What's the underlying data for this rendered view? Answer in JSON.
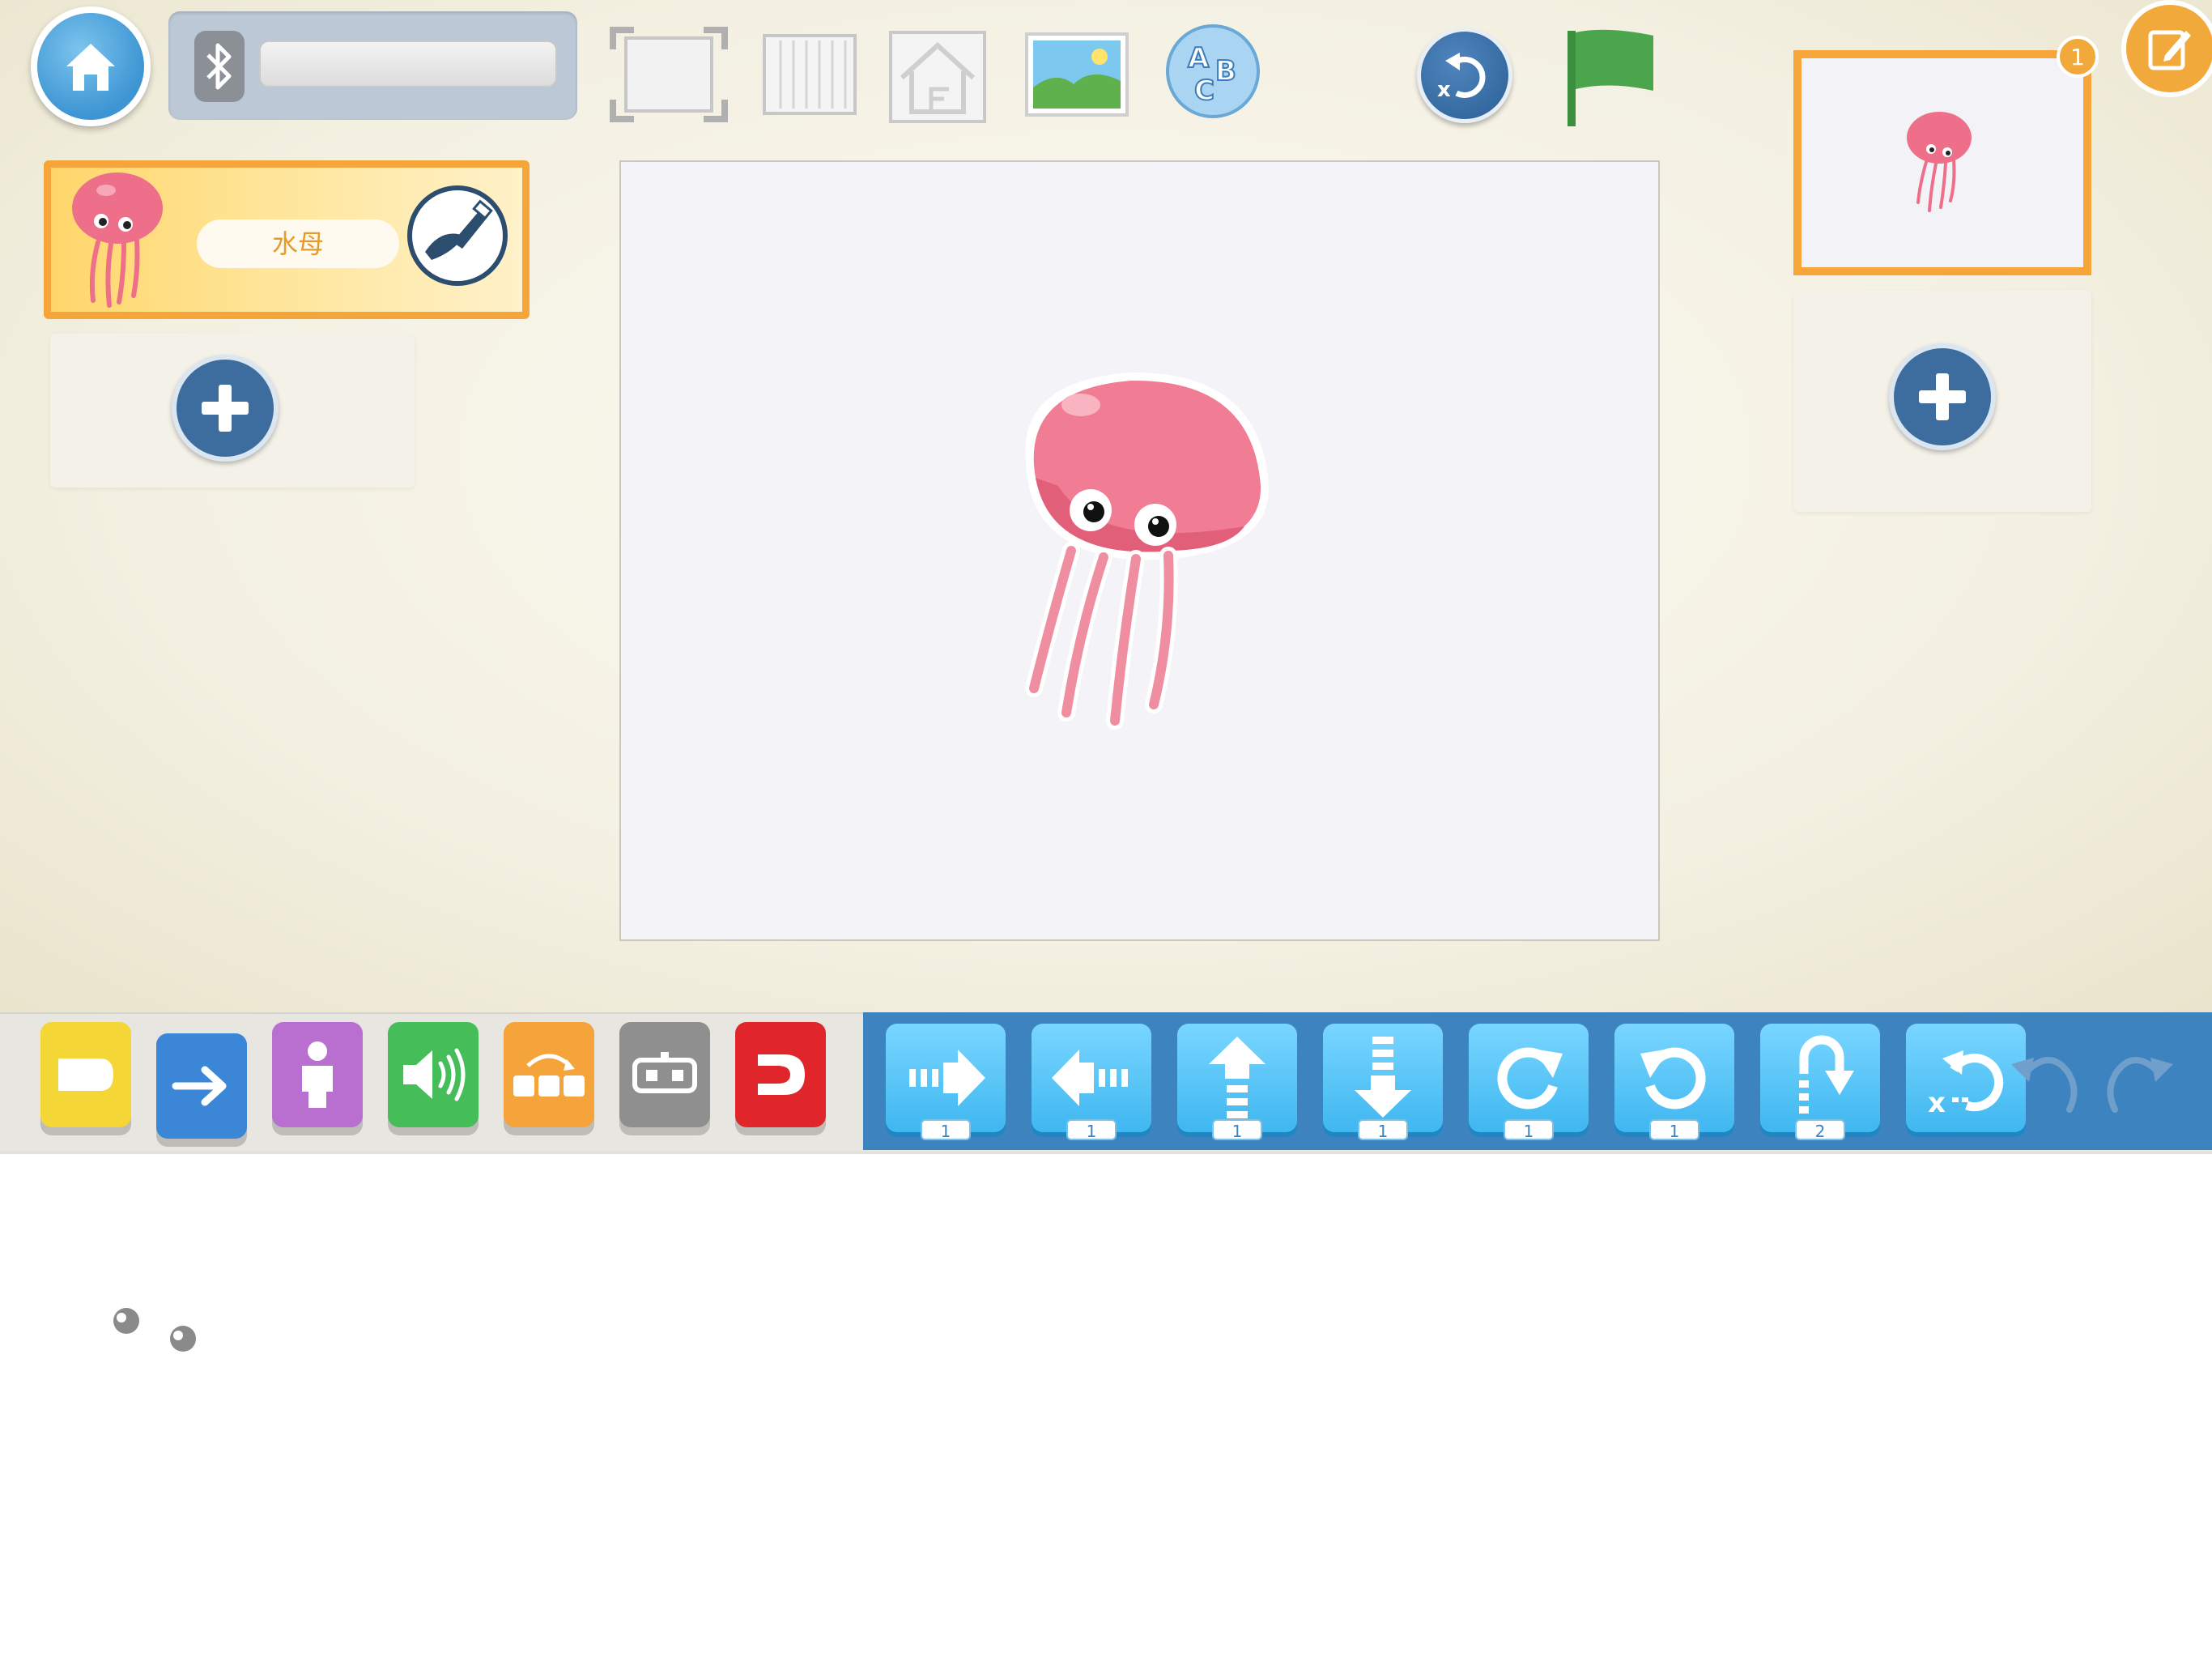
{
  "toolbar": {
    "home_icon": "home-icon",
    "bluetooth_icon": "bluetooth-icon",
    "device_name": "",
    "tools": [
      "fullscreen-icon",
      "grid-icon",
      "page-home-icon",
      "background-icon",
      "text-abc-icon"
    ],
    "reset_icon": "reset-icon",
    "green_flag_icon": "green-flag-icon"
  },
  "sprites": {
    "items": [
      {
        "name": "水母",
        "icon": "jellyfish-icon"
      }
    ],
    "add_icon": "plus-icon"
  },
  "pages": {
    "count_badge": "1",
    "add_icon": "plus-icon",
    "options_icon": "edit-icon"
  },
  "categories": [
    {
      "id": "triggering",
      "color": "#f4d636",
      "icon": "trigger-icon"
    },
    {
      "id": "motion",
      "color": "#3b86d6",
      "icon": "arrow-right-icon"
    },
    {
      "id": "looks",
      "color": "#b96fd0",
      "icon": "person-icon"
    },
    {
      "id": "sound",
      "color": "#45be5a",
      "icon": "speaker-icon"
    },
    {
      "id": "control",
      "color": "#f4a43b",
      "icon": "control-icon"
    },
    {
      "id": "hardware",
      "color": "#8f8f8f",
      "icon": "robot-icon"
    },
    {
      "id": "end",
      "color": "#e0262a",
      "icon": "end-icon"
    }
  ],
  "blocks": [
    {
      "icon": "move-right-icon",
      "count": "1"
    },
    {
      "icon": "move-left-icon",
      "count": "1"
    },
    {
      "icon": "move-up-icon",
      "count": "1"
    },
    {
      "icon": "move-down-icon",
      "count": "1"
    },
    {
      "icon": "turn-right-icon",
      "count": "1"
    },
    {
      "icon": "turn-left-icon",
      "count": "1"
    },
    {
      "icon": "hop-icon",
      "count": "2"
    },
    {
      "icon": "go-home-icon",
      "count": ""
    }
  ],
  "history": {
    "undo_icon": "undo-icon",
    "redo_icon": "redo-icon"
  },
  "colors": {
    "accent_orange": "#f5a53a",
    "toolbar_blue": "#3d83c0",
    "block_blue": "#3fb7f0"
  }
}
